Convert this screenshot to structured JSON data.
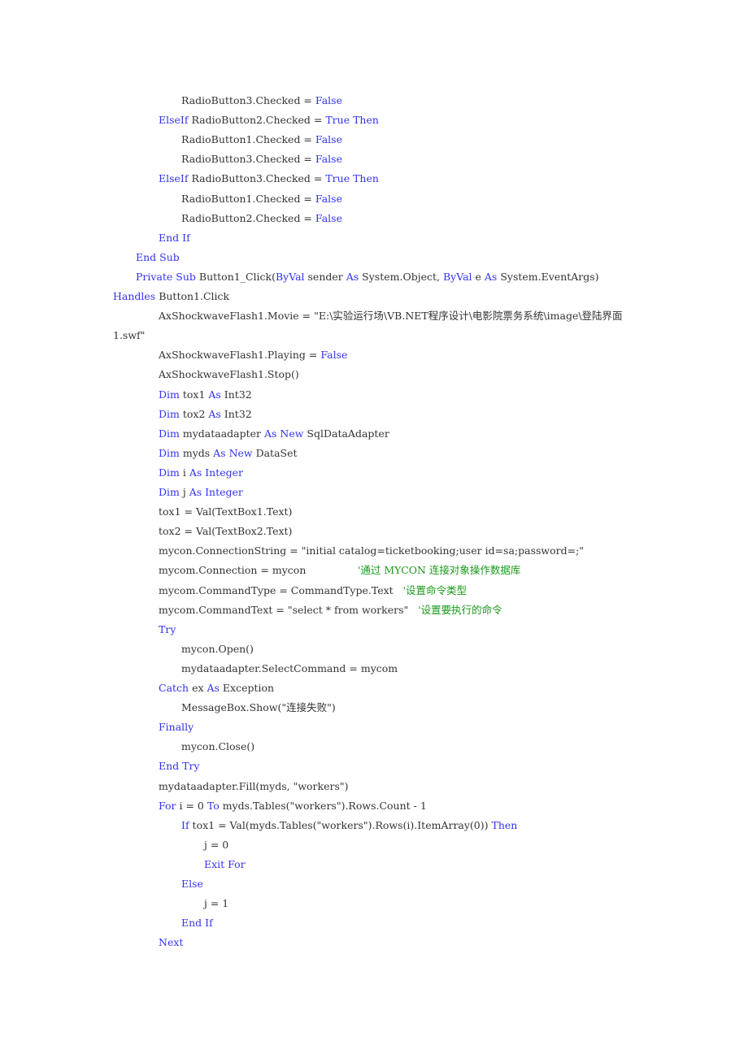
{
  "document": {
    "language": "VB.NET",
    "colors": {
      "keyword": "#3333ee",
      "comment": "#1a9a1a",
      "text": "#333333",
      "background": "#ffffff"
    },
    "lines": [
      {
        "indent": 3,
        "tokens": [
          {
            "t": "tx",
            "v": "RadioButton3.Checked = "
          },
          {
            "t": "kw",
            "v": "False"
          }
        ]
      },
      {
        "indent": 2,
        "tokens": [
          {
            "t": "kw",
            "v": "ElseIf"
          },
          {
            "t": "tx",
            "v": " RadioButton2.Checked = "
          },
          {
            "t": "kw",
            "v": "True"
          },
          {
            "t": "tx",
            "v": " "
          },
          {
            "t": "kw",
            "v": "Then"
          }
        ]
      },
      {
        "indent": 3,
        "tokens": [
          {
            "t": "tx",
            "v": "RadioButton1.Checked = "
          },
          {
            "t": "kw",
            "v": "False"
          }
        ]
      },
      {
        "indent": 3,
        "tokens": [
          {
            "t": "tx",
            "v": "RadioButton3.Checked = "
          },
          {
            "t": "kw",
            "v": "False"
          }
        ]
      },
      {
        "indent": 2,
        "tokens": [
          {
            "t": "kw",
            "v": "ElseIf"
          },
          {
            "t": "tx",
            "v": " RadioButton3.Checked = "
          },
          {
            "t": "kw",
            "v": "True"
          },
          {
            "t": "tx",
            "v": " "
          },
          {
            "t": "kw",
            "v": "Then"
          }
        ]
      },
      {
        "indent": 3,
        "tokens": [
          {
            "t": "tx",
            "v": "RadioButton1.Checked = "
          },
          {
            "t": "kw",
            "v": "False"
          }
        ]
      },
      {
        "indent": 3,
        "tokens": [
          {
            "t": "tx",
            "v": "RadioButton2.Checked = "
          },
          {
            "t": "kw",
            "v": "False"
          }
        ]
      },
      {
        "indent": 2,
        "tokens": [
          {
            "t": "kw",
            "v": "End If"
          }
        ]
      },
      {
        "indent": 1,
        "tokens": [
          {
            "t": "kw",
            "v": "End Sub"
          }
        ]
      },
      {
        "indent": 1,
        "tokens": [
          {
            "t": "kw",
            "v": "Private Sub"
          },
          {
            "t": "tx",
            "v": " Button1_Click("
          },
          {
            "t": "kw",
            "v": "ByVal"
          },
          {
            "t": "tx",
            "v": " sender "
          },
          {
            "t": "kw",
            "v": "As"
          },
          {
            "t": "tx",
            "v": " System.Object, "
          },
          {
            "t": "kw",
            "v": "ByVal"
          },
          {
            "t": "tx",
            "v": " e "
          },
          {
            "t": "kw",
            "v": "As"
          },
          {
            "t": "tx",
            "v": " System.EventArgs)"
          }
        ]
      },
      {
        "indent": 0,
        "tokens": [
          {
            "t": "kw",
            "v": "Handles"
          },
          {
            "t": "tx",
            "v": " Button1.Click"
          }
        ]
      },
      {
        "indent": 2,
        "tokens": [
          {
            "t": "tx",
            "v": "AxShockwaveFlash1.Movie = \"E:\\实验运行场\\VB.NET程序设计\\电影院票务系统\\image\\登陆界面"
          }
        ]
      },
      {
        "indent": 0,
        "tokens": [
          {
            "t": "tx",
            "v": "1.swf\""
          }
        ]
      },
      {
        "indent": 2,
        "tokens": [
          {
            "t": "tx",
            "v": "AxShockwaveFlash1.Playing = "
          },
          {
            "t": "kw",
            "v": "False"
          }
        ]
      },
      {
        "indent": 2,
        "tokens": [
          {
            "t": "tx",
            "v": "AxShockwaveFlash1.Stop()"
          }
        ]
      },
      {
        "indent": 2,
        "tokens": [
          {
            "t": "kw",
            "v": "Dim"
          },
          {
            "t": "tx",
            "v": " tox1 "
          },
          {
            "t": "kw",
            "v": "As"
          },
          {
            "t": "tx",
            "v": " Int32"
          }
        ]
      },
      {
        "indent": 2,
        "tokens": [
          {
            "t": "kw",
            "v": "Dim"
          },
          {
            "t": "tx",
            "v": " tox2 "
          },
          {
            "t": "kw",
            "v": "As"
          },
          {
            "t": "tx",
            "v": " Int32"
          }
        ]
      },
      {
        "indent": 2,
        "tokens": [
          {
            "t": "kw",
            "v": "Dim"
          },
          {
            "t": "tx",
            "v": " mydataadapter "
          },
          {
            "t": "kw",
            "v": "As New"
          },
          {
            "t": "tx",
            "v": " SqlDataAdapter"
          }
        ]
      },
      {
        "indent": 2,
        "tokens": [
          {
            "t": "kw",
            "v": "Dim"
          },
          {
            "t": "tx",
            "v": " myds "
          },
          {
            "t": "kw",
            "v": "As New"
          },
          {
            "t": "tx",
            "v": " DataSet"
          }
        ]
      },
      {
        "indent": 2,
        "tokens": [
          {
            "t": "kw",
            "v": "Dim"
          },
          {
            "t": "tx",
            "v": " i "
          },
          {
            "t": "kw",
            "v": "As Integer"
          }
        ]
      },
      {
        "indent": 2,
        "tokens": [
          {
            "t": "kw",
            "v": "Dim"
          },
          {
            "t": "tx",
            "v": " j "
          },
          {
            "t": "kw",
            "v": "As Integer"
          }
        ]
      },
      {
        "indent": 2,
        "tokens": [
          {
            "t": "tx",
            "v": "tox1 = Val(TextBox1.Text)"
          }
        ]
      },
      {
        "indent": 2,
        "tokens": [
          {
            "t": "tx",
            "v": "tox2 = Val(TextBox2.Text)"
          }
        ]
      },
      {
        "indent": 2,
        "tokens": [
          {
            "t": "tx",
            "v": "mycon.ConnectionString = \"initial catalog=ticketbooking;user id=sa;password=;\""
          }
        ]
      },
      {
        "indent": 2,
        "tokens": [
          {
            "t": "tx",
            "v": "mycom.Connection = mycon                "
          },
          {
            "t": "cm",
            "v": "'通过 MYCON 连接对象操作数据库"
          }
        ]
      },
      {
        "indent": 2,
        "tokens": [
          {
            "t": "tx",
            "v": "mycom.CommandType = CommandType.Text   "
          },
          {
            "t": "cm",
            "v": "'设置命令类型"
          }
        ]
      },
      {
        "indent": 2,
        "tokens": [
          {
            "t": "tx",
            "v": "mycom.CommandText = \"select * from workers\"   "
          },
          {
            "t": "cm",
            "v": "'设置要执行的命令"
          }
        ]
      },
      {
        "indent": 2,
        "tokens": [
          {
            "t": "kw",
            "v": "Try"
          }
        ]
      },
      {
        "indent": 3,
        "tokens": [
          {
            "t": "tx",
            "v": "mycon.Open()"
          }
        ]
      },
      {
        "indent": 3,
        "tokens": [
          {
            "t": "tx",
            "v": "mydataadapter.SelectCommand = mycom"
          }
        ]
      },
      {
        "indent": 2,
        "tokens": [
          {
            "t": "kw",
            "v": "Catch"
          },
          {
            "t": "tx",
            "v": " ex "
          },
          {
            "t": "kw",
            "v": "As"
          },
          {
            "t": "tx",
            "v": " Exception"
          }
        ]
      },
      {
        "indent": 3,
        "tokens": [
          {
            "t": "tx",
            "v": "MessageBox.Show(\"连接失败\")"
          }
        ]
      },
      {
        "indent": 2,
        "tokens": [
          {
            "t": "kw",
            "v": "Finally"
          }
        ]
      },
      {
        "indent": 3,
        "tokens": [
          {
            "t": "tx",
            "v": "mycon.Close()"
          }
        ]
      },
      {
        "indent": 2,
        "tokens": [
          {
            "t": "kw",
            "v": "End Try"
          }
        ]
      },
      {
        "indent": 2,
        "tokens": [
          {
            "t": "tx",
            "v": "mydataadapter.Fill(myds, \"workers\")"
          }
        ]
      },
      {
        "indent": 2,
        "tokens": [
          {
            "t": "kw",
            "v": "For"
          },
          {
            "t": "tx",
            "v": " i = 0 "
          },
          {
            "t": "kw",
            "v": "To"
          },
          {
            "t": "tx",
            "v": " myds.Tables(\"workers\").Rows.Count - 1"
          }
        ]
      },
      {
        "indent": 3,
        "tokens": [
          {
            "t": "kw",
            "v": "If"
          },
          {
            "t": "tx",
            "v": " tox1 = Val(myds.Tables(\"workers\").Rows(i).ItemArray(0)) "
          },
          {
            "t": "kw",
            "v": "Then"
          }
        ]
      },
      {
        "indent": 4,
        "tokens": [
          {
            "t": "tx",
            "v": "j = 0"
          }
        ]
      },
      {
        "indent": 4,
        "tokens": [
          {
            "t": "kw",
            "v": "Exit For"
          }
        ]
      },
      {
        "indent": 3,
        "tokens": [
          {
            "t": "kw",
            "v": "Else"
          }
        ]
      },
      {
        "indent": 4,
        "tokens": [
          {
            "t": "tx",
            "v": "j = 1"
          }
        ]
      },
      {
        "indent": 3,
        "tokens": [
          {
            "t": "kw",
            "v": "End If"
          }
        ]
      },
      {
        "indent": 2,
        "tokens": [
          {
            "t": "kw",
            "v": "Next"
          }
        ]
      }
    ]
  }
}
